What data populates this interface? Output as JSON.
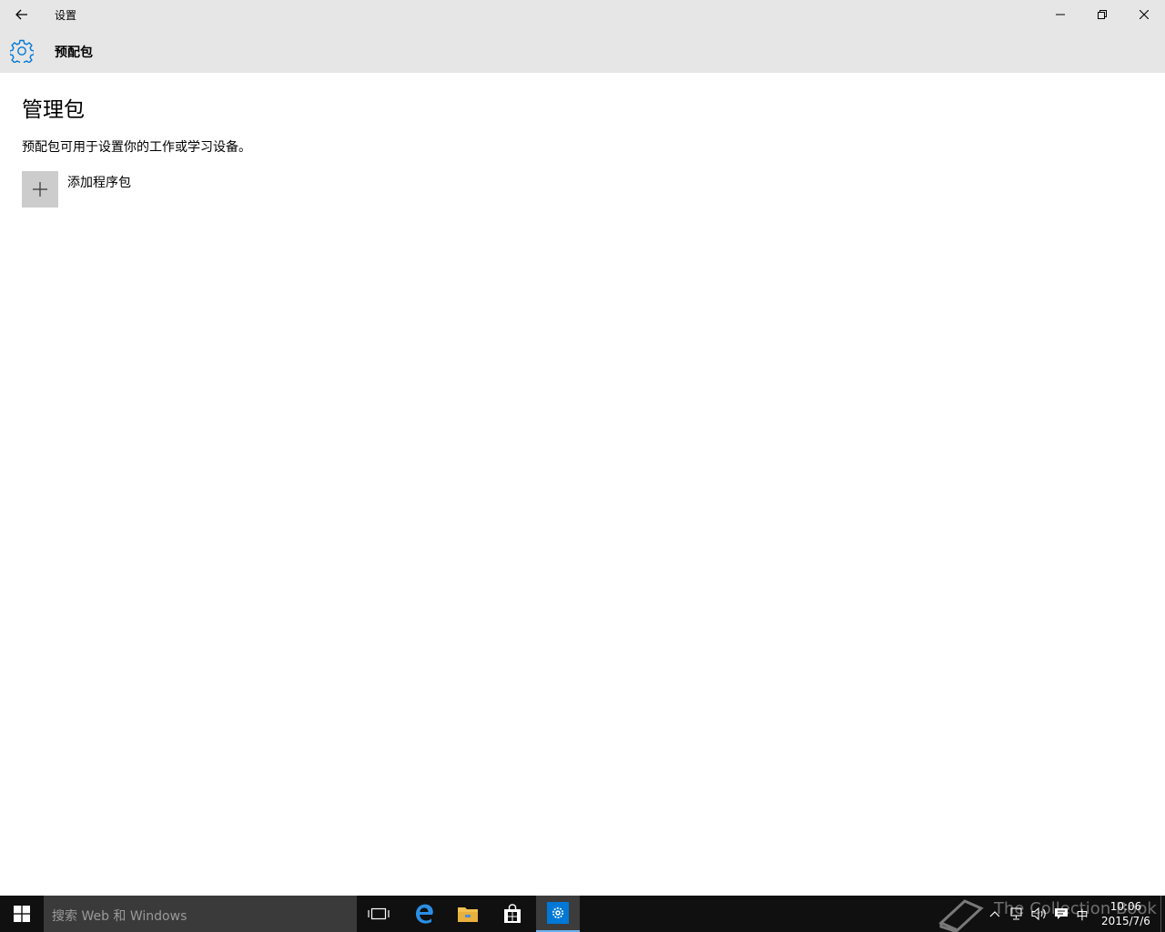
{
  "window": {
    "app_title": "设置",
    "header_title": "预配包"
  },
  "page": {
    "heading": "管理包",
    "description": "预配包可用于设置你的工作或学习设备。",
    "add_package_label": "添加程序包"
  },
  "taskbar": {
    "search_placeholder": "搜索 Web 和 Windows",
    "ime_indicator": "中",
    "time": "10:06",
    "date": "2015/7/6",
    "watermark_text": "The Collection Book"
  },
  "colors": {
    "accent": "#0078d7",
    "titlebar_bg": "#e6e6e6",
    "taskbar_bg": "#101010",
    "add_tile_bg": "#cccccc"
  }
}
